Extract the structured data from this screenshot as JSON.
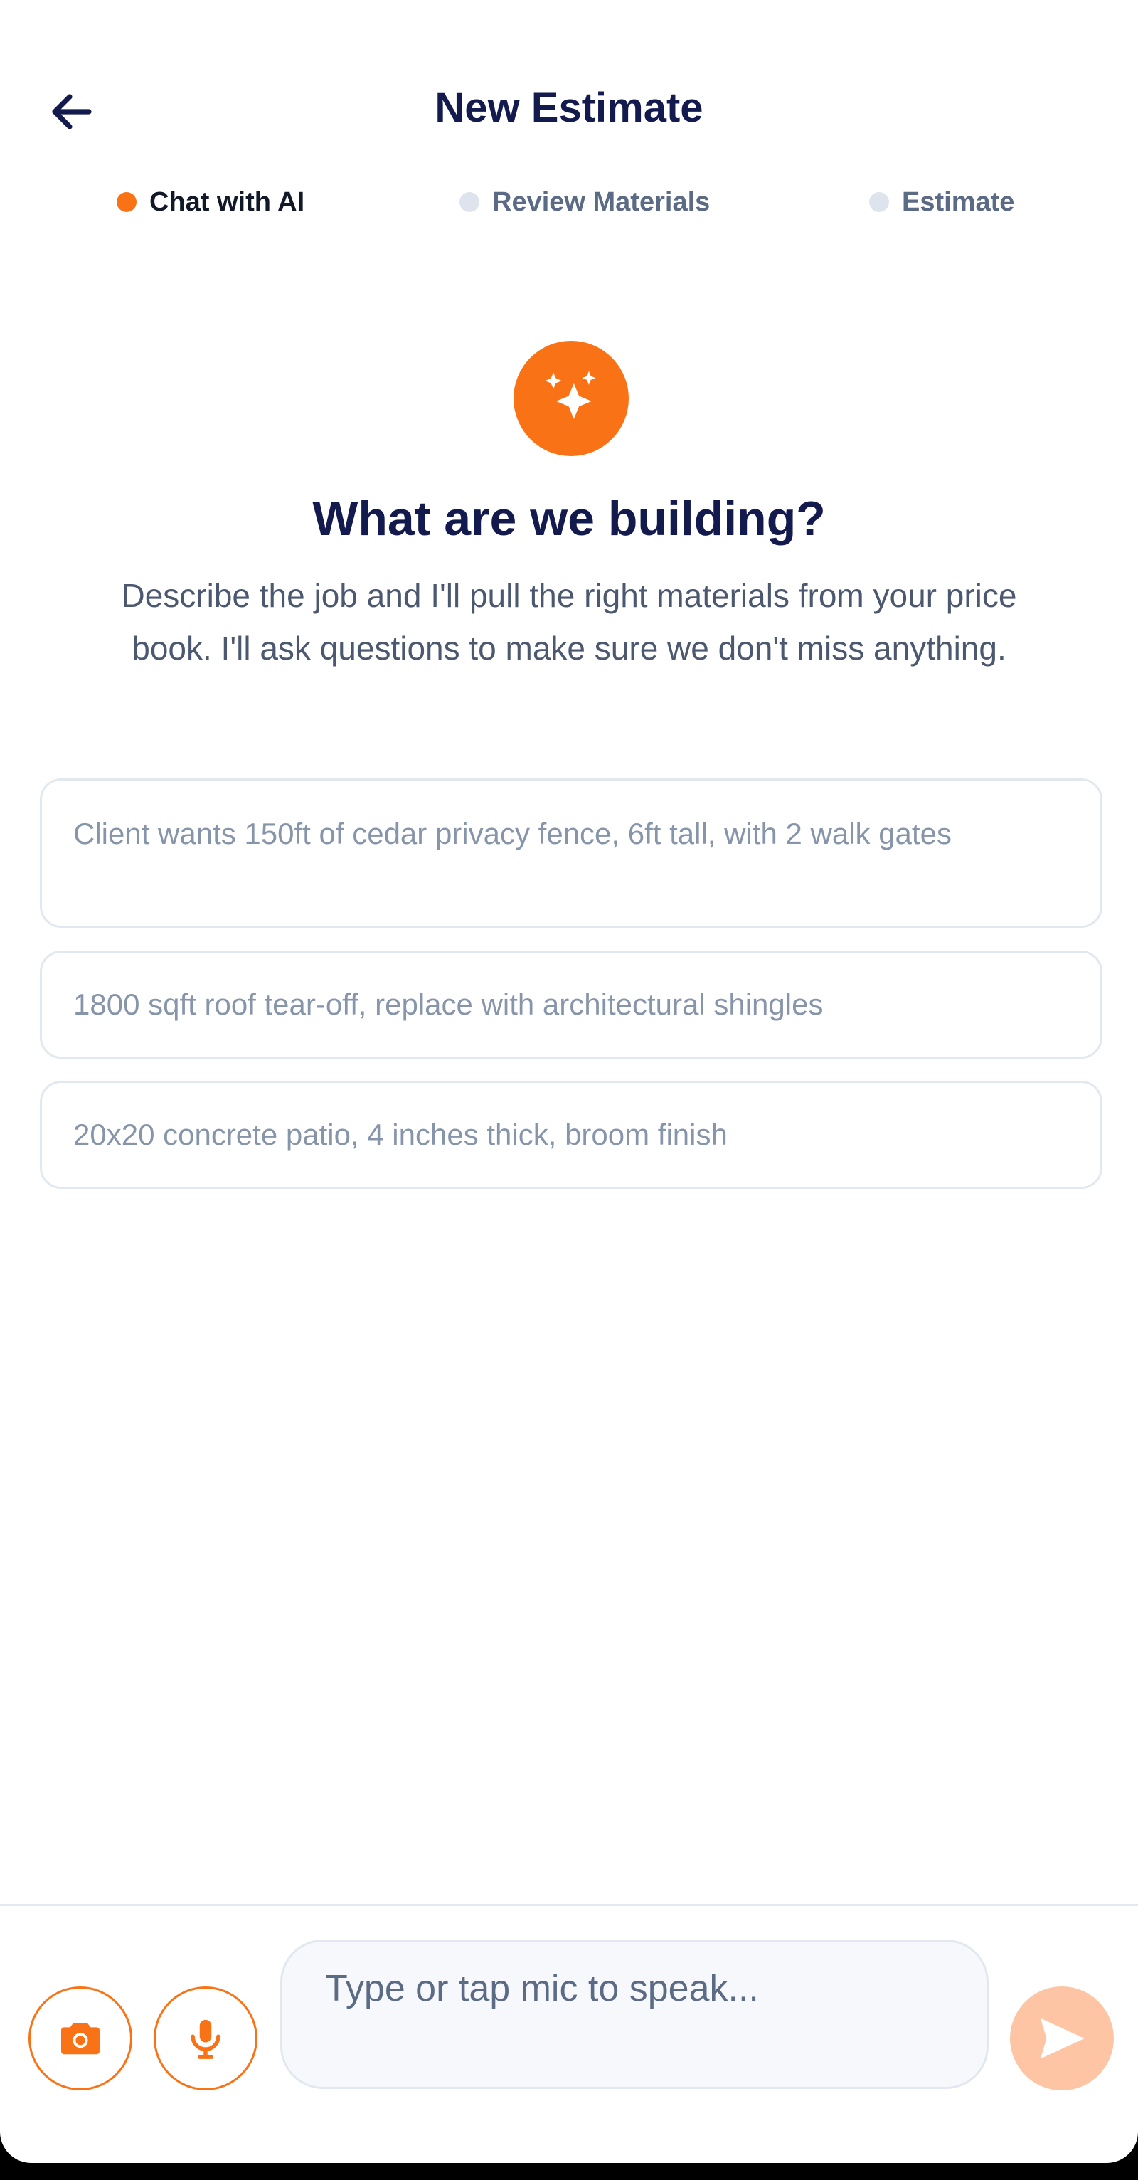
{
  "header": {
    "title": "New Estimate",
    "back_icon": "arrow-left-icon"
  },
  "steps": [
    {
      "label": "Chat with AI",
      "state": "active"
    },
    {
      "label": "Review Materials",
      "state": "inactive"
    },
    {
      "label": "Estimate",
      "state": "inactive"
    }
  ],
  "hero": {
    "icon": "sparkles-icon",
    "title": "What are we building?",
    "description": "Describe the job and I'll pull the right materials from your price book. I'll ask questions to make sure we don't miss anything."
  },
  "suggestions": [
    "Client wants 150ft of cedar privacy fence, 6ft tall, with 2 walk gates",
    "1800 sqft roof tear-off, replace with architectural shingles",
    "20x20 concrete patio, 4 inches thick, broom finish"
  ],
  "composer": {
    "placeholder": "Type or tap mic to speak...",
    "value": "",
    "camera_icon": "camera-icon",
    "mic_icon": "microphone-icon",
    "send_icon": "send-icon"
  },
  "colors": {
    "accent": "#f97316",
    "accent_disabled": "#fdc5a3",
    "title_navy": "#131a4d",
    "muted_text": "#4b5870",
    "placeholder_text": "#8795aa",
    "border": "#e2e8f0"
  }
}
